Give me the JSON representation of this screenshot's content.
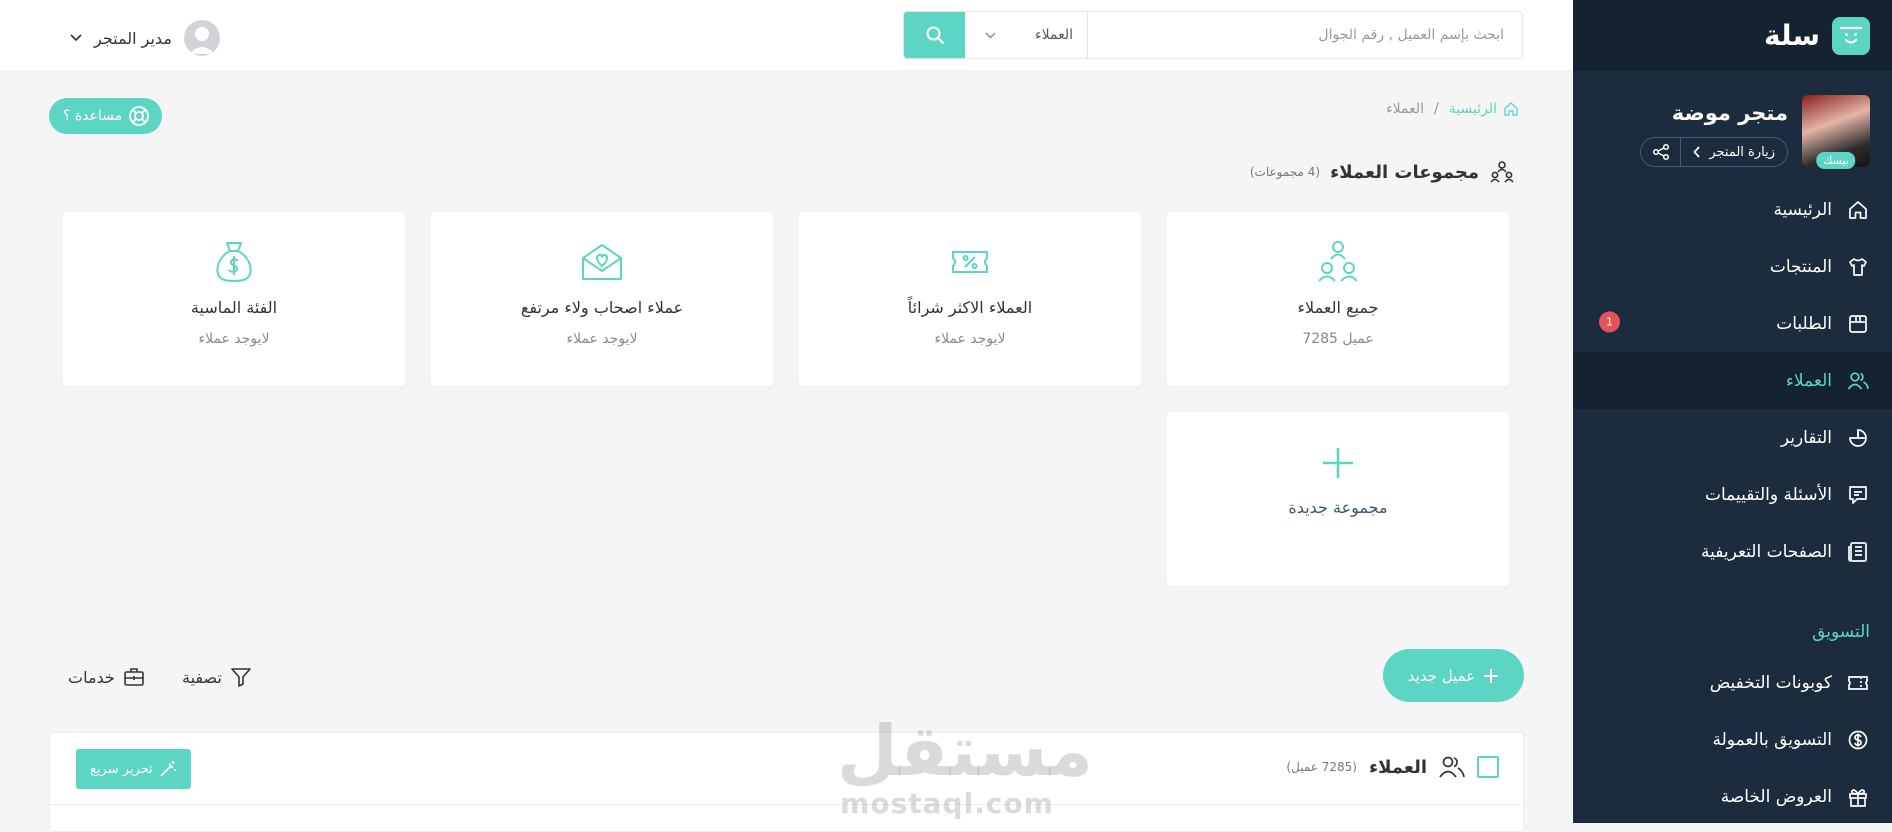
{
  "sidebar": {
    "logo_text": "سلة",
    "store": {
      "name": "متجر موضة",
      "badge": "بيسك",
      "visit_label": "زيارة المتجر"
    },
    "items": [
      {
        "label": "الرئيسية",
        "icon": "home-icon"
      },
      {
        "label": "المنتجات",
        "icon": "shirt-icon"
      },
      {
        "label": "الطلبات",
        "icon": "box-icon",
        "badge": "1"
      },
      {
        "label": "العملاء",
        "icon": "users-icon",
        "active": true
      },
      {
        "label": "التقارير",
        "icon": "pie-chart-icon"
      },
      {
        "label": "الأسئلة والتقييمات",
        "icon": "message-icon"
      },
      {
        "label": "الصفحات التعريفية",
        "icon": "newspaper-icon"
      }
    ],
    "marketing_section": "التسويق",
    "marketing_items": [
      {
        "label": "كوبونات التخفيض",
        "icon": "ticket-icon"
      },
      {
        "label": "التسويق بالعمولة",
        "icon": "dollar-circle-icon"
      },
      {
        "label": "العروض الخاصة",
        "icon": "gift-icon"
      }
    ]
  },
  "topbar": {
    "user_label": "مدير المتجر",
    "search": {
      "placeholder": "ابحث بإسم العميل , رقم الجوال",
      "scope": "العملاء"
    }
  },
  "main": {
    "help_label": "مساعدة ؟",
    "breadcrumb": {
      "home": "الرئيسية",
      "separator": "/",
      "current": "العملاء"
    },
    "groups_title": "مجموعات العملاء",
    "groups_count": "(4 مجموعات)",
    "groups": [
      {
        "title": "جميع العملاء",
        "subtitle": "7285 عميل",
        "icon": "users-group-icon"
      },
      {
        "title": "العملاء الاكثر شرائاً",
        "subtitle": "لايوجد عملاء",
        "icon": "discount-ticket-icon"
      },
      {
        "title": "عملاء اصحاب ولاء مرتفع",
        "subtitle": "لايوجد عملاء",
        "icon": "heart-envelope-icon"
      },
      {
        "title": "الفئة الماسية",
        "subtitle": "لايوجد عملاء",
        "icon": "money-bag-icon"
      }
    ],
    "new_group_label": "مجموعة جديدة",
    "add_customer_label": "عميل جديد",
    "filter_label": "تصفية",
    "services_label": "خدمات",
    "table": {
      "title": "العملاء",
      "count": "(7285 عميل)",
      "quick_edit_label": "تحرير سريع"
    }
  },
  "watermark": {
    "arabic": "مستقل",
    "latin": "mostaql.com"
  },
  "colors": {
    "accent": "#5dd5c4",
    "sidebar_bg": "#1c2b3d",
    "sidebar_dark": "#15222f",
    "notification": "#e4525a"
  }
}
